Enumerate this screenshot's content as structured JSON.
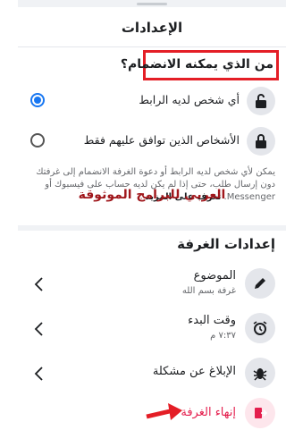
{
  "header": {
    "title": "الإعدادات"
  },
  "question": "من الذي يمكنه الانضمام؟",
  "options": [
    {
      "label": "أي شخص لديه الرابط",
      "selected": true,
      "icon": "unlock-icon"
    },
    {
      "label": "الأشخاص الذين توافق عليهم فقط",
      "selected": false,
      "icon": "lock-icon"
    }
  ],
  "description": {
    "text": "يمكن لأي شخص لديه الرابط أو دعوة الغرفة الانضمام إلى غرفتك دون إرسال طلب، حتى إذا لم يكن لديه حساب على فيسبوك أو Messenger. ",
    "link": "تعرف على المزيد"
  },
  "watermark": "العربي للبرامج الموثوقة",
  "room_settings": {
    "title": "إعدادات الغرفة",
    "items": [
      {
        "label": "الموضوع",
        "sub": "غرفة بسم الله",
        "icon": "pencil-icon"
      },
      {
        "label": "وقت البدء",
        "sub": "٧:٣٧ م",
        "icon": "alarm-clock-icon"
      },
      {
        "label": "الإبلاغ عن مشكلة",
        "sub": "",
        "icon": "bug-icon"
      }
    ]
  },
  "end_room": {
    "label": "إنهاء الغرفة",
    "icon": "exit-icon",
    "color": "#e41e4d"
  },
  "colors": {
    "accent": "#1877f2",
    "highlight": "#e41e26"
  }
}
